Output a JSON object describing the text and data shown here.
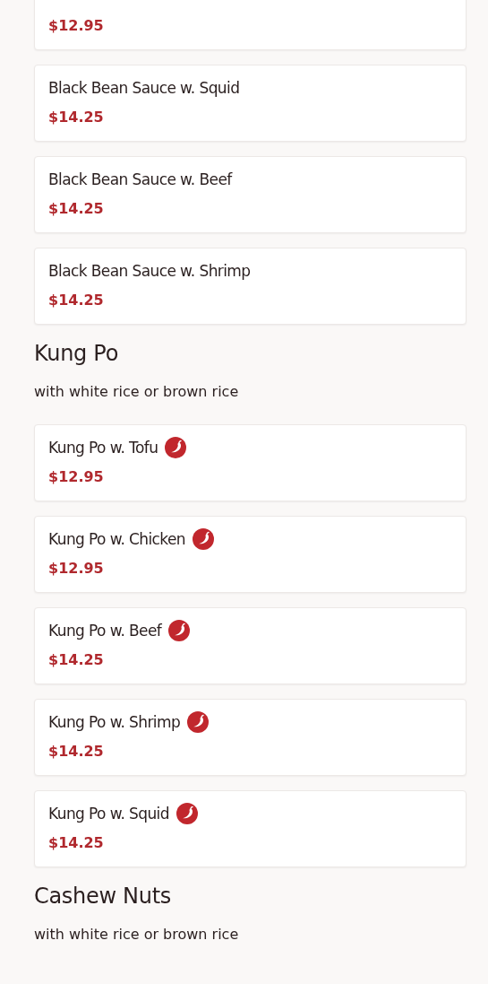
{
  "sections": [
    {
      "items": [
        {
          "price": "$12.95"
        },
        {
          "name": "Black Bean Sauce w. Squid",
          "price": "$14.25",
          "spicy": false
        },
        {
          "name": "Black Bean Sauce w. Beef",
          "price": "$14.25",
          "spicy": false
        },
        {
          "name": "Black Bean Sauce w. Shrimp",
          "price": "$14.25",
          "spicy": false
        }
      ]
    },
    {
      "heading": "Kung Po",
      "subtitle": "with white rice or brown rice",
      "items": [
        {
          "name": "Kung Po w. Tofu",
          "price": "$12.95",
          "spicy": true
        },
        {
          "name": "Kung Po w. Chicken",
          "price": "$12.95",
          "spicy": true
        },
        {
          "name": "Kung Po w. Beef",
          "price": "$14.25",
          "spicy": true
        },
        {
          "name": "Kung Po w. Shrimp",
          "price": "$14.25",
          "spicy": true
        },
        {
          "name": "Kung Po w. Squid",
          "price": "$14.25",
          "spicy": true
        }
      ]
    },
    {
      "heading": "Cashew Nuts",
      "subtitle": "with white rice or brown rice"
    }
  ]
}
